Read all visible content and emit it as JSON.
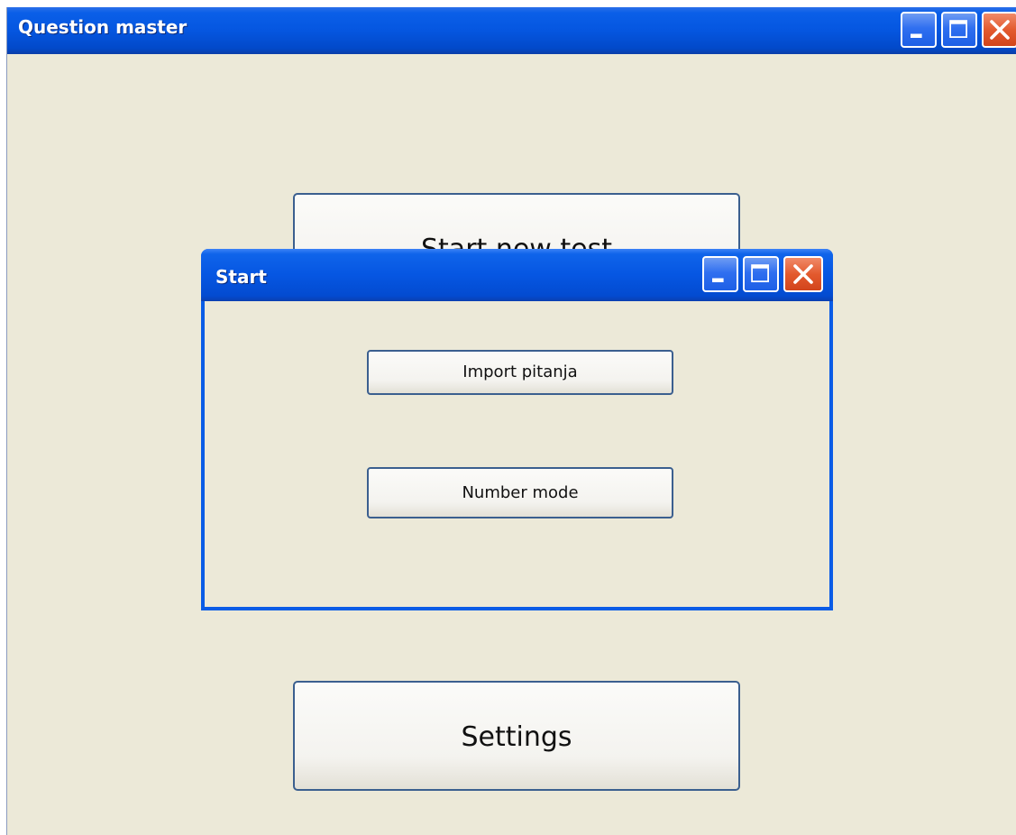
{
  "main_window": {
    "title": "Question master",
    "buttons": {
      "start_new_test": "Start new test",
      "settings": "Settings"
    }
  },
  "dialog": {
    "title": "Start",
    "buttons": {
      "import": "Import pitanja",
      "number_mode": "Number mode"
    }
  },
  "window_controls": [
    "minimize-icon",
    "maximize-icon",
    "close-icon"
  ],
  "colors": {
    "titlebar_blue": "#0556e0",
    "window_background": "#ece9d8",
    "close_red": "#e35a2e",
    "button_border": "#3b5f8f"
  }
}
